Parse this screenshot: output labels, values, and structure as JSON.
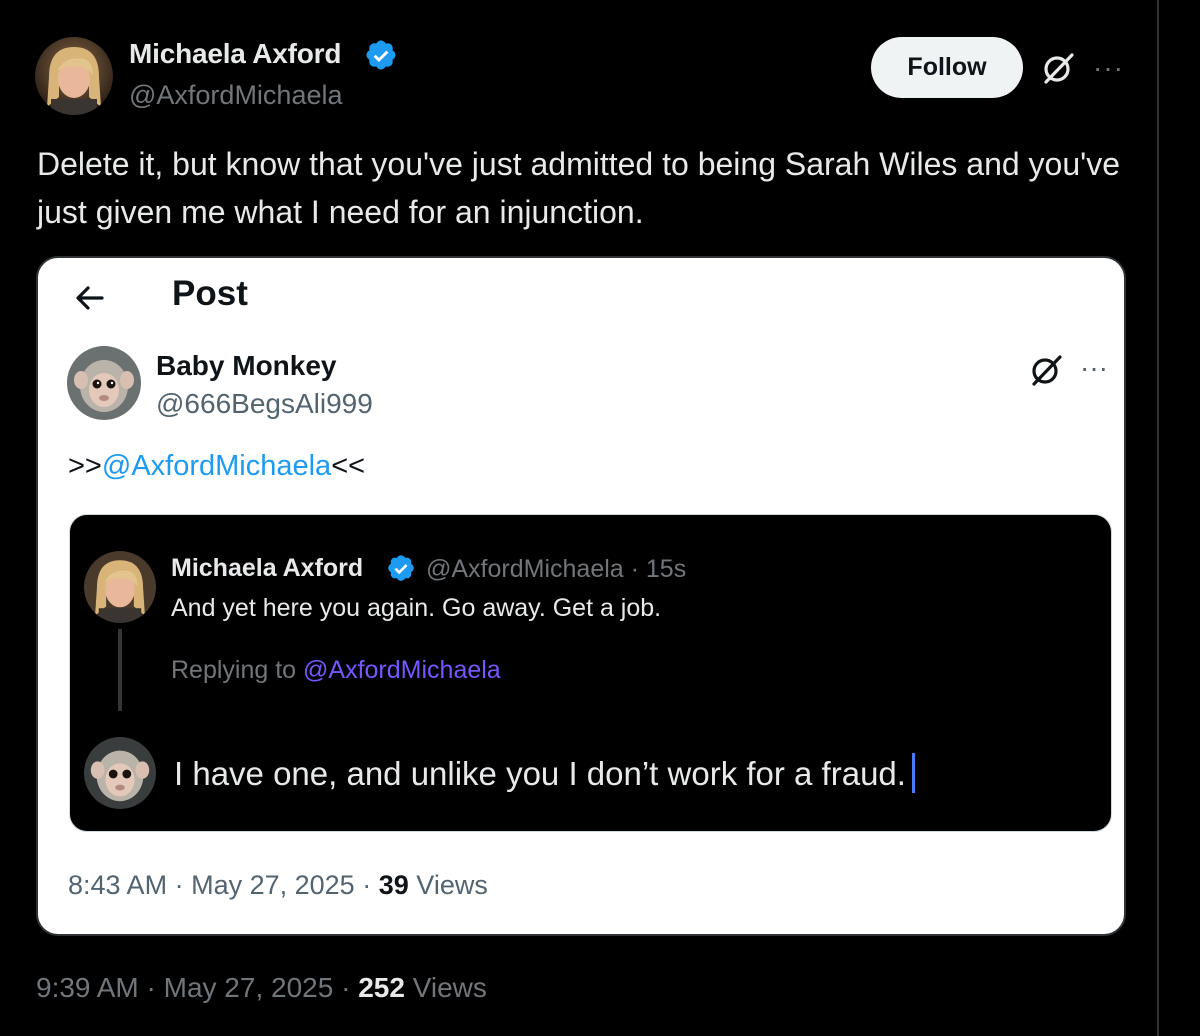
{
  "tweet": {
    "author_name": "Michaela Axford",
    "author_handle": "@AxfordMichaela",
    "follow_label": "Follow",
    "more_label": "···",
    "text": "Delete it, but know that you've just admitted to being  Sarah Wiles and you've just given me what I need for an injunction.",
    "time": "9:39 AM",
    "date": "May 27, 2025",
    "views_count": "252",
    "views_label": "Views",
    "separator": "·"
  },
  "embedded_post": {
    "title": "Post",
    "author_name": "Baby Monkey",
    "author_handle": "@666BegsAli999",
    "more_label": "···",
    "text_prefix": ">>",
    "mention": "@AxfordMichaela",
    "text_suffix": "<<",
    "time": "8:43 AM",
    "date": "May 27, 2025",
    "views_count": "39",
    "views_label": "Views",
    "separator": "·"
  },
  "inner_screenshot": {
    "author_name": "Michaela Axford",
    "handle_time": "@AxfordMichaela · 15s",
    "text": "And yet here you again. Go away. Get a job.",
    "replying_prefix": "Replying to",
    "replying_handle": "@AxfordMichaela",
    "compose_text": "I have one, and unlike you I don’t work for a fraud."
  },
  "icons": {
    "verified": "verified-badge-icon",
    "grok": "grok-icon",
    "back": "back-arrow-icon",
    "more": "more-icon"
  },
  "colors": {
    "background": "#000000",
    "link_blue": "#1d9bf0",
    "verified_blue": "#1d9bf0",
    "replying_purple": "#7856ff",
    "muted": "#71767b"
  }
}
